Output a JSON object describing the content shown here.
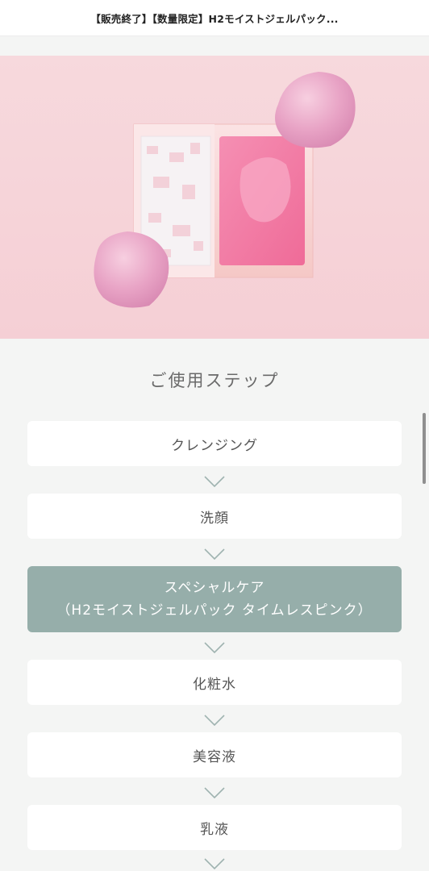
{
  "header": {
    "title": "【販売終了】【数量限定】H2モイストジェルパック..."
  },
  "section": {
    "title": "ご使用ステップ"
  },
  "steps": [
    {
      "label": "クレンジング"
    },
    {
      "label": "洗顔"
    },
    {
      "label": "スペシャルケア",
      "sublabel": "（H2モイストジェルパック タイムレスピンク）",
      "active": true
    },
    {
      "label": "化粧水"
    },
    {
      "label": "美容液"
    },
    {
      "label": "乳液"
    }
  ],
  "colors": {
    "active_step": "#96aeaa",
    "hero_bg": "#f6d3d8",
    "arrow": "#9fb3b0"
  },
  "icons": [
    "chevron-down-icon"
  ]
}
